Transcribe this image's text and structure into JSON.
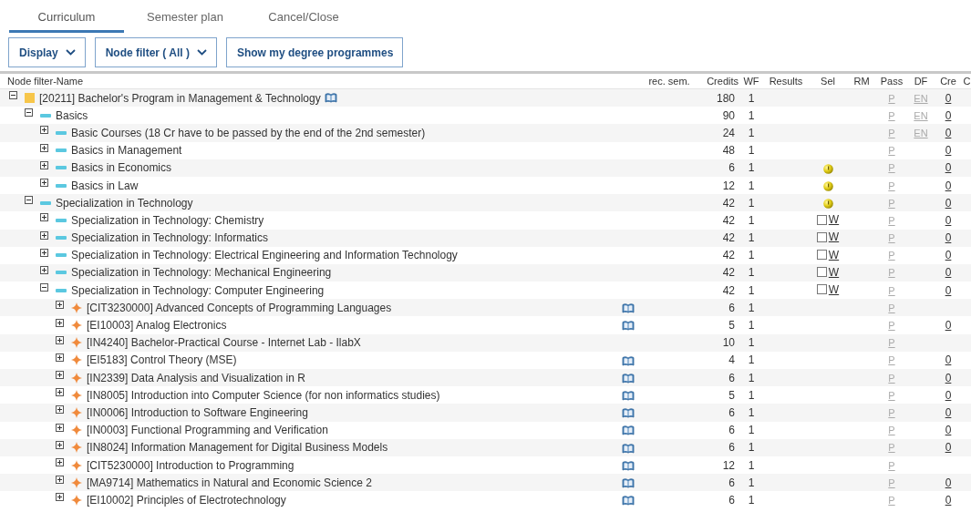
{
  "tabs": [
    {
      "label": "Curriculum",
      "selected": true
    },
    {
      "label": "Semester plan",
      "selected": false
    },
    {
      "label": "Cancel/Close",
      "selected": false
    }
  ],
  "toolbar": [
    {
      "label": "Display",
      "dropdown": true
    },
    {
      "label": "Node filter ( All )",
      "dropdown": true
    },
    {
      "label": "Show my degree programmes",
      "dropdown": false
    }
  ],
  "table": {
    "columns": [
      "Node filter-Name",
      "rec. sem.",
      "Credits",
      "WF",
      "Results",
      "Sel",
      "RM",
      "Pass",
      "DF",
      "Cre",
      "C"
    ],
    "tree": [
      {
        "label": "[20211] Bachelor's Program in Management & Technology",
        "kind": "program",
        "expanded": true,
        "doc": true,
        "credits": "180",
        "wf": "1",
        "pass": "P",
        "df": "EN",
        "cre": "0",
        "children": [
          {
            "label": "Basics",
            "kind": "group",
            "expanded": true,
            "credits": "90",
            "wf": "1",
            "pass": "P",
            "df": "EN",
            "cre": "0",
            "children": [
              {
                "label": "Basic Courses (18 Cr have to be passed by the end of the 2nd semester)",
                "kind": "group",
                "expanded": false,
                "credits": "24",
                "wf": "1",
                "pass": "P",
                "df": "EN",
                "cre": "0"
              },
              {
                "label": "Basics in Management",
                "kind": "group",
                "expanded": false,
                "credits": "48",
                "wf": "1",
                "pass": "P",
                "cre": "0"
              },
              {
                "label": "Basics in Economics",
                "kind": "group",
                "expanded": false,
                "credits": "6",
                "wf": "1",
                "sel": {
                  "kind": "warning"
                },
                "pass": "P",
                "cre": "0"
              },
              {
                "label": "Basics in Law",
                "kind": "group",
                "expanded": false,
                "credits": "12",
                "wf": "1",
                "sel": {
                  "kind": "warning"
                },
                "pass": "P",
                "cre": "0"
              }
            ]
          },
          {
            "label": "Specialization in Technology",
            "kind": "group",
            "expanded": true,
            "credits": "42",
            "wf": "1",
            "sel": {
              "kind": "warning"
            },
            "pass": "P",
            "cre": "0",
            "children": [
              {
                "label": "Specialization in Technology: Chemistry",
                "kind": "group",
                "expanded": false,
                "credits": "42",
                "wf": "1",
                "sel": {
                  "kind": "checkbox",
                  "checked": false,
                  "link": "W"
                },
                "pass": "P",
                "cre": "0"
              },
              {
                "label": "Specialization in Technology: Informatics",
                "kind": "group",
                "expanded": false,
                "credits": "42",
                "wf": "1",
                "sel": {
                  "kind": "checkbox",
                  "checked": false,
                  "link": "W"
                },
                "pass": "P",
                "cre": "0"
              },
              {
                "label": "Specialization in Technology: Electrical Engineering and Information Technology",
                "kind": "group",
                "expanded": false,
                "credits": "42",
                "wf": "1",
                "sel": {
                  "kind": "checkbox",
                  "checked": false,
                  "link": "W"
                },
                "pass": "P",
                "cre": "0"
              },
              {
                "label": "Specialization in Technology: Mechanical Engineering",
                "kind": "group",
                "expanded": false,
                "credits": "42",
                "wf": "1",
                "sel": {
                  "kind": "checkbox",
                  "checked": false,
                  "link": "W"
                },
                "pass": "P",
                "cre": "0"
              },
              {
                "label": "Specialization in Technology: Computer Engineering",
                "kind": "group",
                "expanded": true,
                "credits": "42",
                "wf": "1",
                "sel": {
                  "kind": "checkbox",
                  "checked": false,
                  "link": "W"
                },
                "pass": "P",
                "cre": "0",
                "children": [
                  {
                    "label": "[CIT3230000] Advanced Concepts of Programming Languages",
                    "kind": "module",
                    "expanded": false,
                    "doc": true,
                    "credits": "6",
                    "wf": "1",
                    "pass": "P"
                  },
                  {
                    "label": "[EI10003] Analog Electronics",
                    "kind": "module",
                    "expanded": false,
                    "doc": true,
                    "credits": "5",
                    "wf": "1",
                    "pass": "P",
                    "cre": "0"
                  },
                  {
                    "label": "[IN4240] Bachelor-Practical Course - Internet Lab - IlabX",
                    "kind": "module",
                    "expanded": false,
                    "doc": false,
                    "credits": "10",
                    "wf": "1",
                    "pass": "P"
                  },
                  {
                    "label": "[EI5183] Control Theory (MSE)",
                    "kind": "module",
                    "expanded": false,
                    "doc": true,
                    "credits": "4",
                    "wf": "1",
                    "pass": "P",
                    "cre": "0"
                  },
                  {
                    "label": "[IN2339] Data Analysis and Visualization in R",
                    "kind": "module",
                    "expanded": false,
                    "doc": true,
                    "credits": "6",
                    "wf": "1",
                    "pass": "P",
                    "cre": "0"
                  },
                  {
                    "label": "[IN8005] Introduction into Computer Science (for non informatics studies)",
                    "kind": "module",
                    "expanded": false,
                    "doc": true,
                    "credits": "5",
                    "wf": "1",
                    "pass": "P",
                    "cre": "0"
                  },
                  {
                    "label": "[IN0006] Introduction to Software Engineering",
                    "kind": "module",
                    "expanded": false,
                    "doc": true,
                    "credits": "6",
                    "wf": "1",
                    "pass": "P",
                    "cre": "0"
                  },
                  {
                    "label": "[IN0003] Functional Programming and Verification",
                    "kind": "module",
                    "expanded": false,
                    "doc": true,
                    "credits": "6",
                    "wf": "1",
                    "pass": "P",
                    "cre": "0"
                  },
                  {
                    "label": "[IN8024] Information Management for Digital Business Models",
                    "kind": "module",
                    "expanded": false,
                    "doc": true,
                    "credits": "6",
                    "wf": "1",
                    "pass": "P",
                    "cre": "0"
                  },
                  {
                    "label": "[CIT5230000] Introduction to Programming",
                    "kind": "module",
                    "expanded": false,
                    "doc": true,
                    "credits": "12",
                    "wf": "1",
                    "pass": "P"
                  },
                  {
                    "label": "[MA9714] Mathematics in Natural and Economic Science 2",
                    "kind": "module",
                    "expanded": false,
                    "doc": true,
                    "credits": "6",
                    "wf": "1",
                    "pass": "P",
                    "cre": "0"
                  },
                  {
                    "label": "[EI10002] Principles of Electrotechnology",
                    "kind": "module",
                    "expanded": false,
                    "doc": true,
                    "credits": "6",
                    "wf": "1",
                    "pass": "P",
                    "cre": "0"
                  }
                ]
              }
            ]
          }
        ]
      }
    ]
  }
}
